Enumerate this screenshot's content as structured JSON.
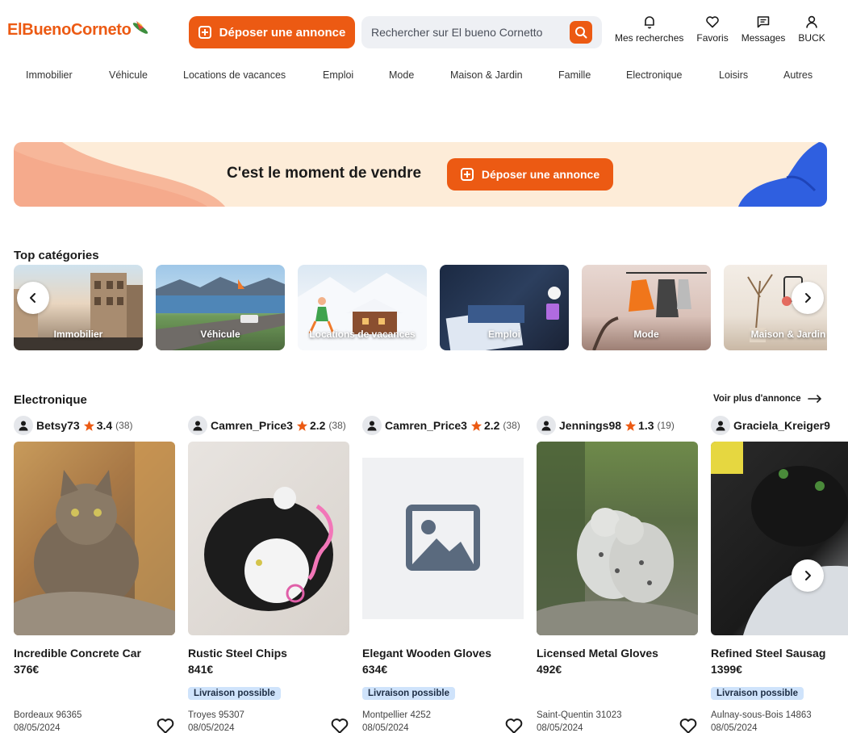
{
  "header": {
    "logo": "ElBuenoCorneto",
    "deposit_label": "Déposer une annonce",
    "search_placeholder": "Rechercher sur El bueno Cornetto",
    "nav": [
      {
        "label": "Mes recherches",
        "icon": "bell-icon"
      },
      {
        "label": "Favoris",
        "icon": "heart-icon"
      },
      {
        "label": "Messages",
        "icon": "message-icon"
      },
      {
        "label": "BUCK",
        "icon": "user-icon"
      }
    ]
  },
  "categories": [
    "Immobilier",
    "Véhicule",
    "Locations de vacances",
    "Emploi",
    "Mode",
    "Maison & Jardin",
    "Famille",
    "Electronique",
    "Loisirs",
    "Autres"
  ],
  "banner": {
    "title": "C'est le moment de vendre",
    "button_label": "Déposer une annonce"
  },
  "top_categories": {
    "title": "Top catégories",
    "items": [
      {
        "label": "Immobilier"
      },
      {
        "label": "Véhicule"
      },
      {
        "label": "Locations de vacances"
      },
      {
        "label": "Emploi"
      },
      {
        "label": "Mode"
      },
      {
        "label": "Maison & Jardin"
      }
    ]
  },
  "electronique": {
    "title": "Electronique",
    "see_more": "Voir plus d'annonce",
    "listings": [
      {
        "seller": "Betsy73",
        "rating": "3.4",
        "count": "(38)",
        "title": "Incredible Concrete Car",
        "price": "376€",
        "badge": "",
        "location": "Bordeaux 96365",
        "date": "08/05/2024"
      },
      {
        "seller": "Camren_Price3",
        "rating": "2.2",
        "count": "(38)",
        "title": "Rustic Steel Chips",
        "price": "841€",
        "badge": "Livraison possible",
        "location": "Troyes 95307",
        "date": "08/05/2024"
      },
      {
        "seller": "Camren_Price3",
        "rating": "2.2",
        "count": "(38)",
        "title": "Elegant Wooden Gloves",
        "price": "634€",
        "badge": "Livraison possible",
        "location": "Montpellier 4252",
        "date": "08/05/2024"
      },
      {
        "seller": "Jennings98",
        "rating": "1.3",
        "count": "(19)",
        "title": "Licensed Metal Gloves",
        "price": "492€",
        "badge": "",
        "location": "Saint-Quentin 31023",
        "date": "08/05/2024"
      },
      {
        "seller": "Graciela_Kreiger9",
        "rating": "",
        "count": "",
        "title": "Refined Steel Sausag",
        "price": "1399€",
        "badge": "Livraison possible",
        "location": "Aulnay-sous-Bois 14863",
        "date": "08/05/2024"
      }
    ]
  },
  "colors": {
    "accent": "#ec5a13",
    "badge_bg": "#cfe3fb",
    "banner_bg": "#fdecd8",
    "star": "#ec5a13"
  }
}
